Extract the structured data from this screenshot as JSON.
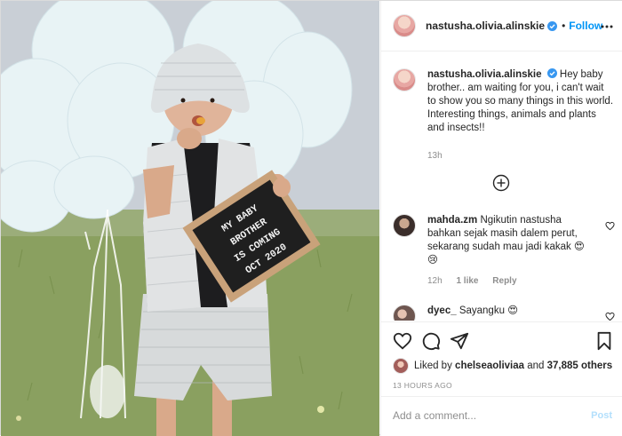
{
  "post": {
    "author": "nastusha.olivia.alinskie",
    "follow_label": "Follow",
    "separator": "•",
    "caption": {
      "author": "nastusha.olivia.alinskie",
      "text": "Hey baby brother.. am waiting for you, i can't wait to show you so many things in this world. Interesting things, animals and plants and insects!!",
      "age": "13h"
    },
    "photo": {
      "letter_board_lines": [
        "MY BABY",
        "BROTHER",
        "IS COMING",
        "OCT 2020"
      ]
    },
    "comments": [
      {
        "author": "mahda.zm",
        "text": "Ngikutin nastusha bahkan sejak masih dalem perut, sekarang sudah mau jadi kakak 😍 😢",
        "age": "12h",
        "likes": "1 like",
        "reply_label": "Reply"
      },
      {
        "author": "dyec_",
        "text": "Sayangku 😍"
      }
    ],
    "liked_by": {
      "prefix": "Liked by",
      "user": "chelseaoliviaa",
      "connector": "and",
      "others": "37,885 others"
    },
    "timestamp": "13 HOURS AGO",
    "add_comment_placeholder": "Add a comment...",
    "post_label": "Post"
  },
  "icons": {
    "verified": "verified-badge-icon",
    "more": "more-options-icon",
    "like": "heart-icon",
    "comment": "comment-bubble-icon",
    "share": "paper-plane-icon",
    "save": "bookmark-icon",
    "load_more": "plus-circle-icon"
  },
  "colors": {
    "accent": "#0095f6",
    "post_disabled": "#b2dffc",
    "muted": "#8e8e8e"
  }
}
